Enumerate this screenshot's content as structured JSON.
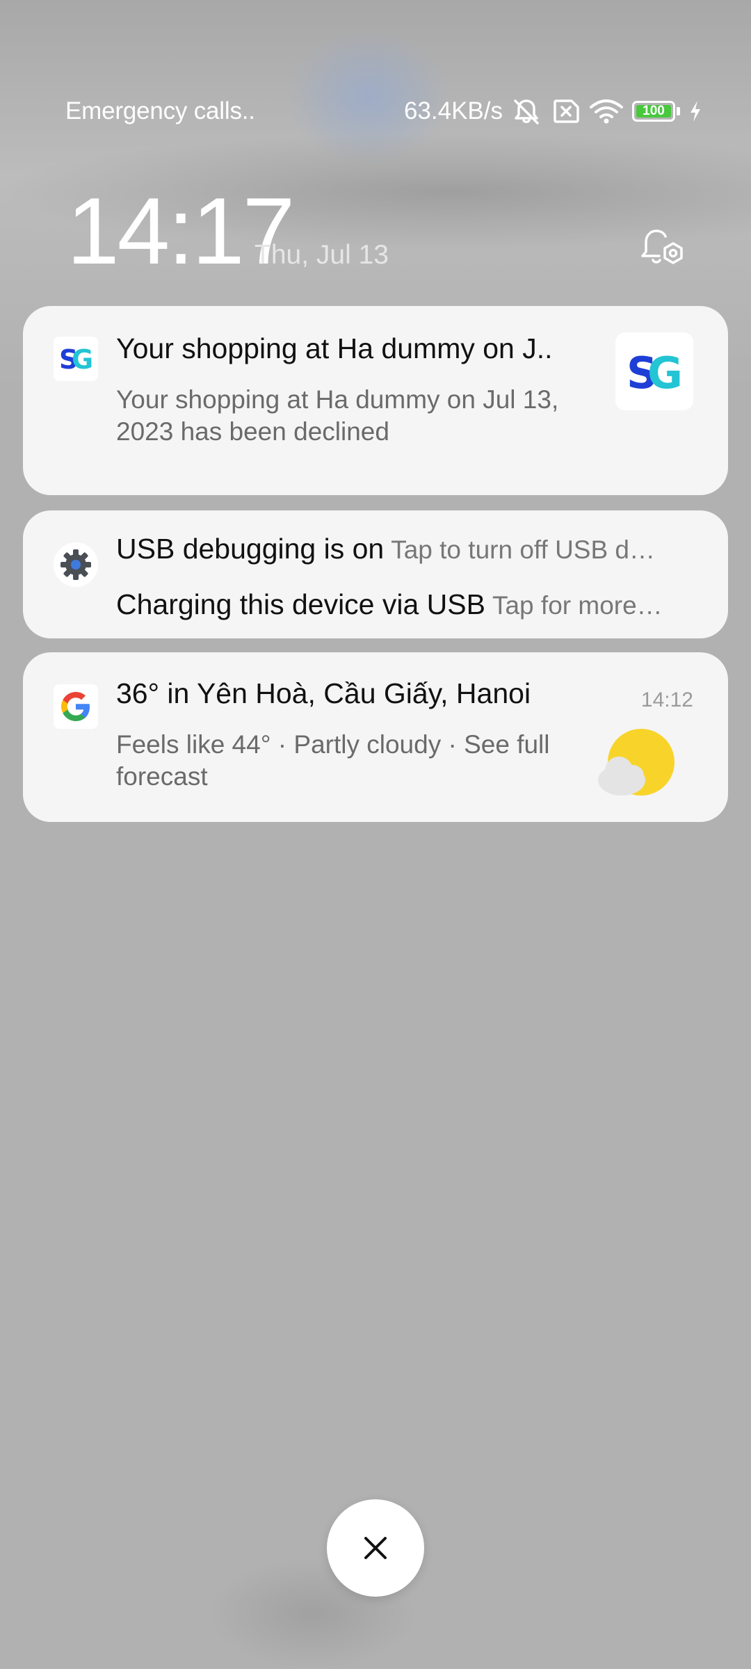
{
  "status_bar": {
    "carrier_text": "Emergency calls..",
    "net_speed": "63.4KB/s",
    "battery_level": "100",
    "battery_color": "#49c83e",
    "icons": [
      "mute-bell-icon",
      "no-sim-icon",
      "wifi-icon",
      "battery-icon",
      "charging-bolt-icon"
    ]
  },
  "lockscreen": {
    "time": "14:17",
    "date": "Thu, Jul 13"
  },
  "notifications": [
    {
      "app_icon": "sg-logo-icon",
      "title": "Your shopping at Ha dummy on J..",
      "body": "Your shopping at Ha dummy on Jul 13, 2023 has been declined"
    },
    {
      "app_icon": "gear-icon",
      "lines": [
        {
          "title": "USB debugging is on",
          "subtitle": "Tap to turn off USB d…"
        },
        {
          "title": "Charging this device via USB",
          "subtitle": "Tap for more…"
        }
      ]
    },
    {
      "app_icon": "google-icon",
      "title": "36° in Yên Hoà, Cầu Giấy, Hanoi",
      "time": "14:12",
      "body": "Feels like 44° · Partly cloudy · See full forecast",
      "weather_icon": "partly-cloudy-icon"
    }
  ],
  "close_button": {
    "icon": "close-icon"
  }
}
